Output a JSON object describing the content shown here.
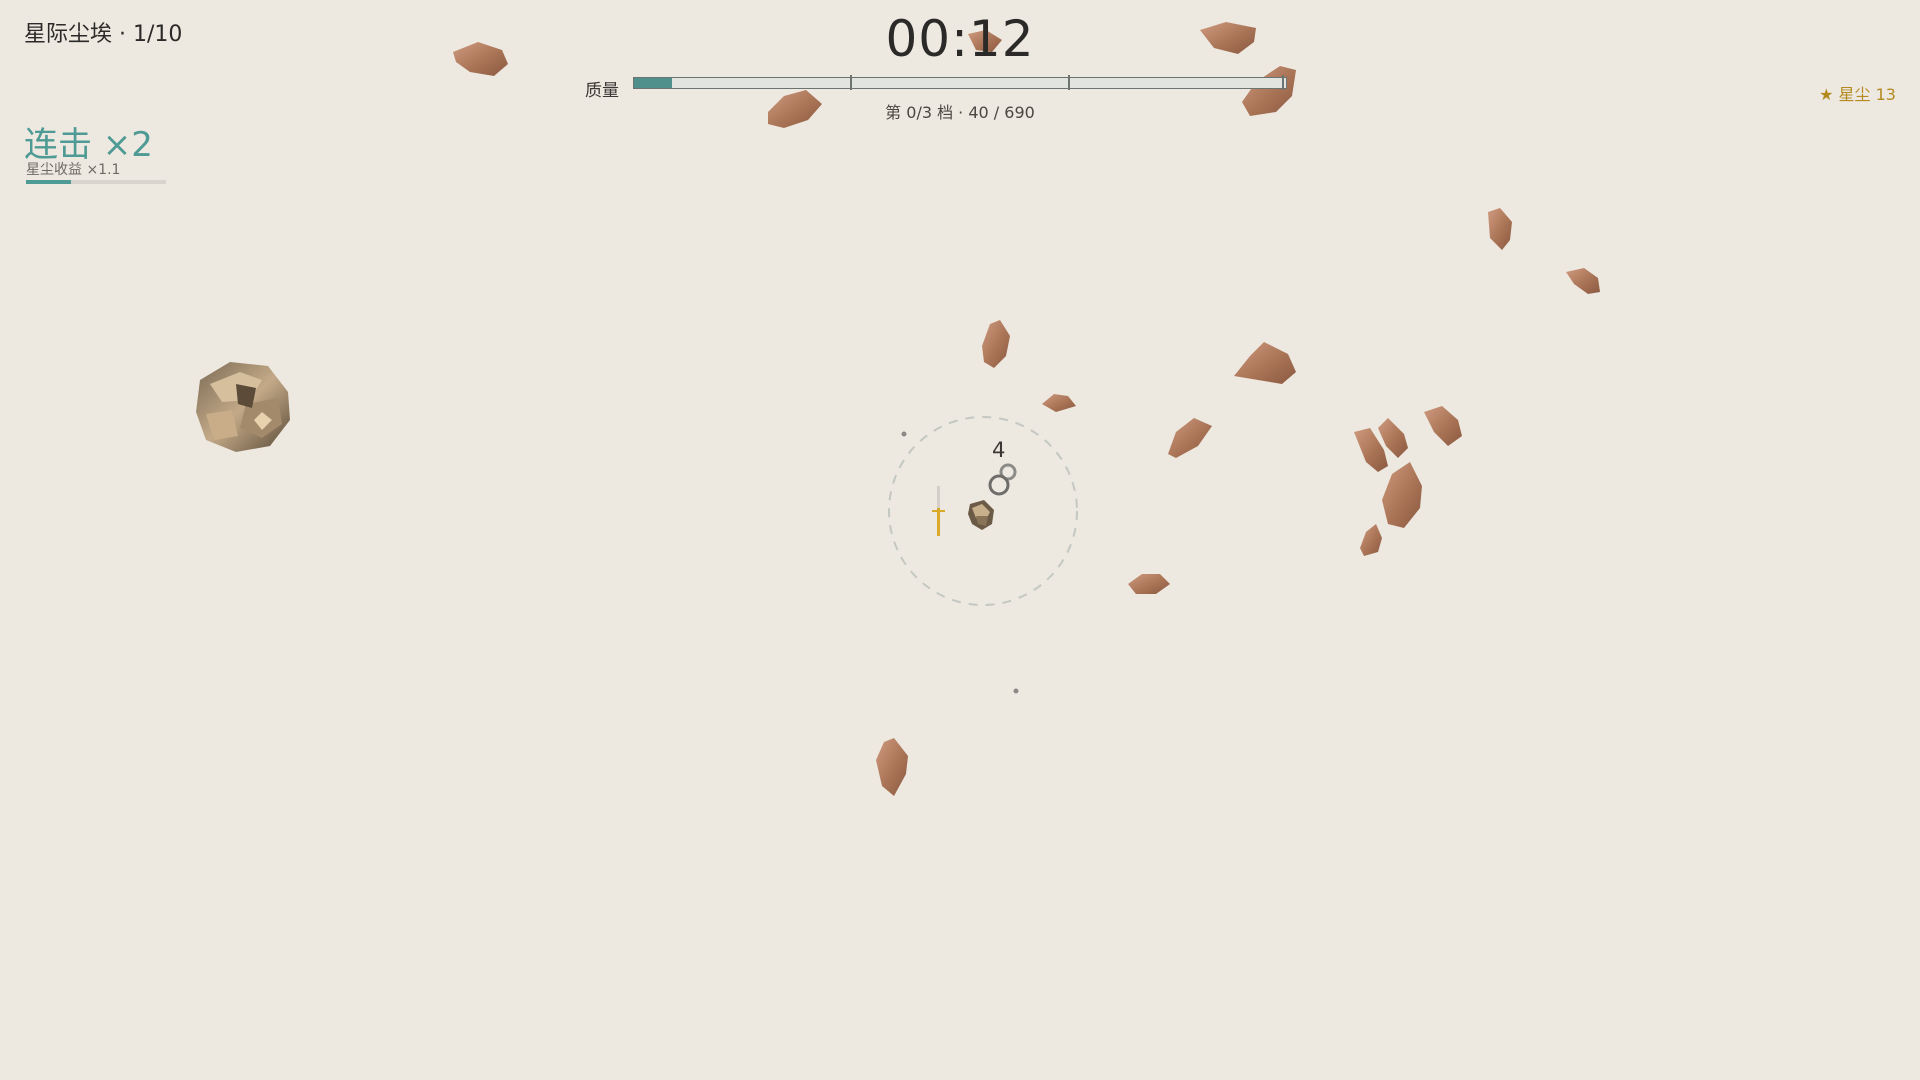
{
  "hud": {
    "level_label": "星际尘埃 · 1/10",
    "timer": "00:12",
    "mass_label": "质量",
    "mass_fraction": 0.058,
    "tier_text": "第 0/3 档 · 40 / 690",
    "stardust_label": "★ 星尘 13"
  },
  "combo": {
    "label": "连击 ×2",
    "subtitle": "星尘收益 ×1.1",
    "progress": 0.32
  },
  "player": {
    "count_label": "4"
  },
  "colors": {
    "background": "#ede8e0",
    "accent": "#4e9a94",
    "gold": "#b38a20",
    "rock": "#b07b5f"
  }
}
